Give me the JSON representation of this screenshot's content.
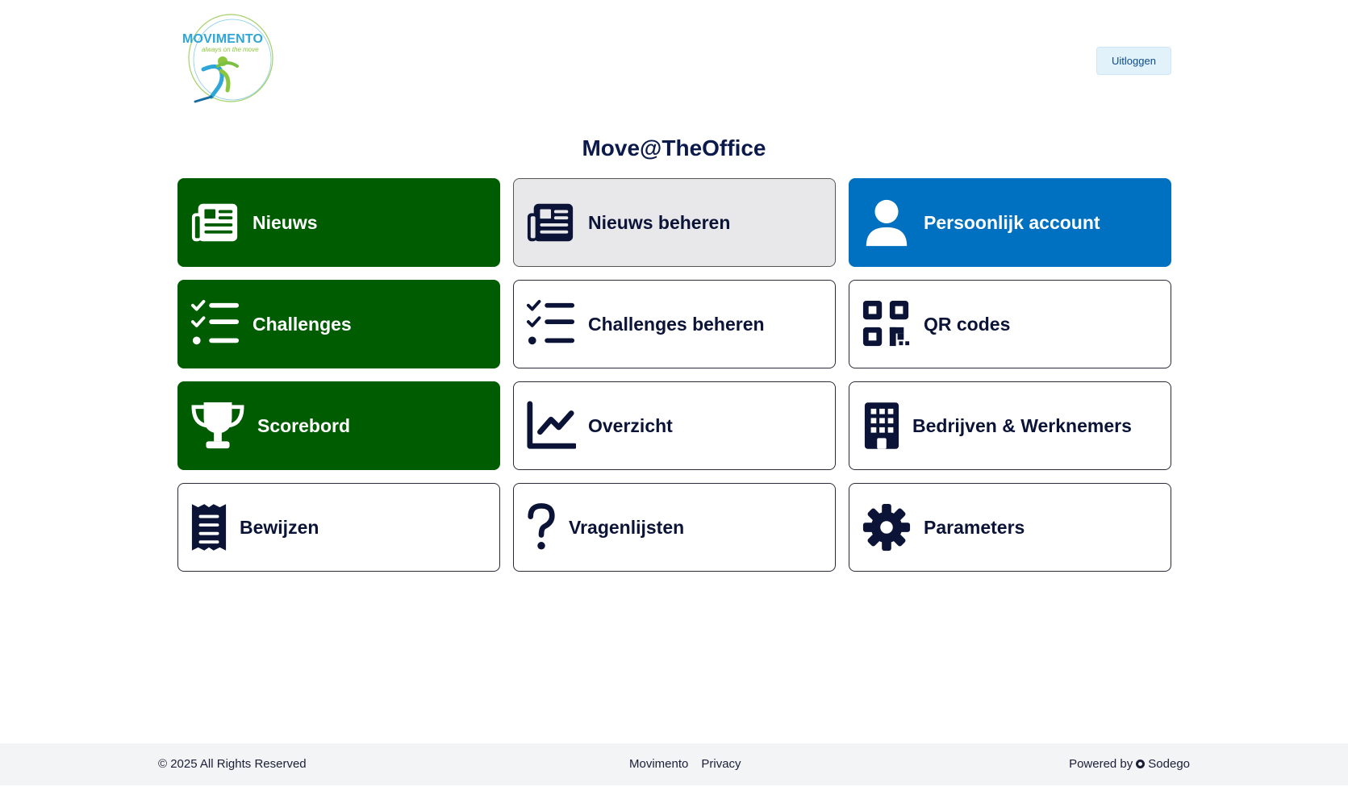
{
  "header": {
    "logo_text": "MOVIMENTO",
    "logo_tagline": "always on the move",
    "logout_label": "Uitloggen"
  },
  "page": {
    "title": "Move@TheOffice"
  },
  "tiles": [
    {
      "label": "Nieuws",
      "icon": "newspaper-icon",
      "style": "green"
    },
    {
      "label": "Nieuws beheren",
      "icon": "newspaper-icon",
      "style": "grey"
    },
    {
      "label": "Persoonlijk account",
      "icon": "user-icon",
      "style": "blue"
    },
    {
      "label": "Challenges",
      "icon": "checklist-icon",
      "style": "green"
    },
    {
      "label": "Challenges beheren",
      "icon": "checklist-icon",
      "style": "white"
    },
    {
      "label": "QR codes",
      "icon": "qrcode-icon",
      "style": "white"
    },
    {
      "label": "Scorebord",
      "icon": "trophy-icon",
      "style": "green"
    },
    {
      "label": "Overzicht",
      "icon": "chart-line-icon",
      "style": "white"
    },
    {
      "label": "Bedrijven & Werknemers",
      "icon": "building-icon",
      "style": "white"
    },
    {
      "label": "Bewijzen",
      "icon": "receipt-icon",
      "style": "white"
    },
    {
      "label": "Vragenlijsten",
      "icon": "question-icon",
      "style": "white"
    },
    {
      "label": "Parameters",
      "icon": "gear-icon",
      "style": "white"
    }
  ],
  "colors": {
    "green": "#005c00",
    "blue": "#0070c0",
    "grey": "#e8e8ea",
    "navy": "#0b1437"
  },
  "footer": {
    "copyright": "© 2025 All Rights Reserved",
    "link_movimento": "Movimento",
    "link_privacy": "Privacy",
    "powered_prefix": "Powered by",
    "powered_brand": "Sodego"
  }
}
